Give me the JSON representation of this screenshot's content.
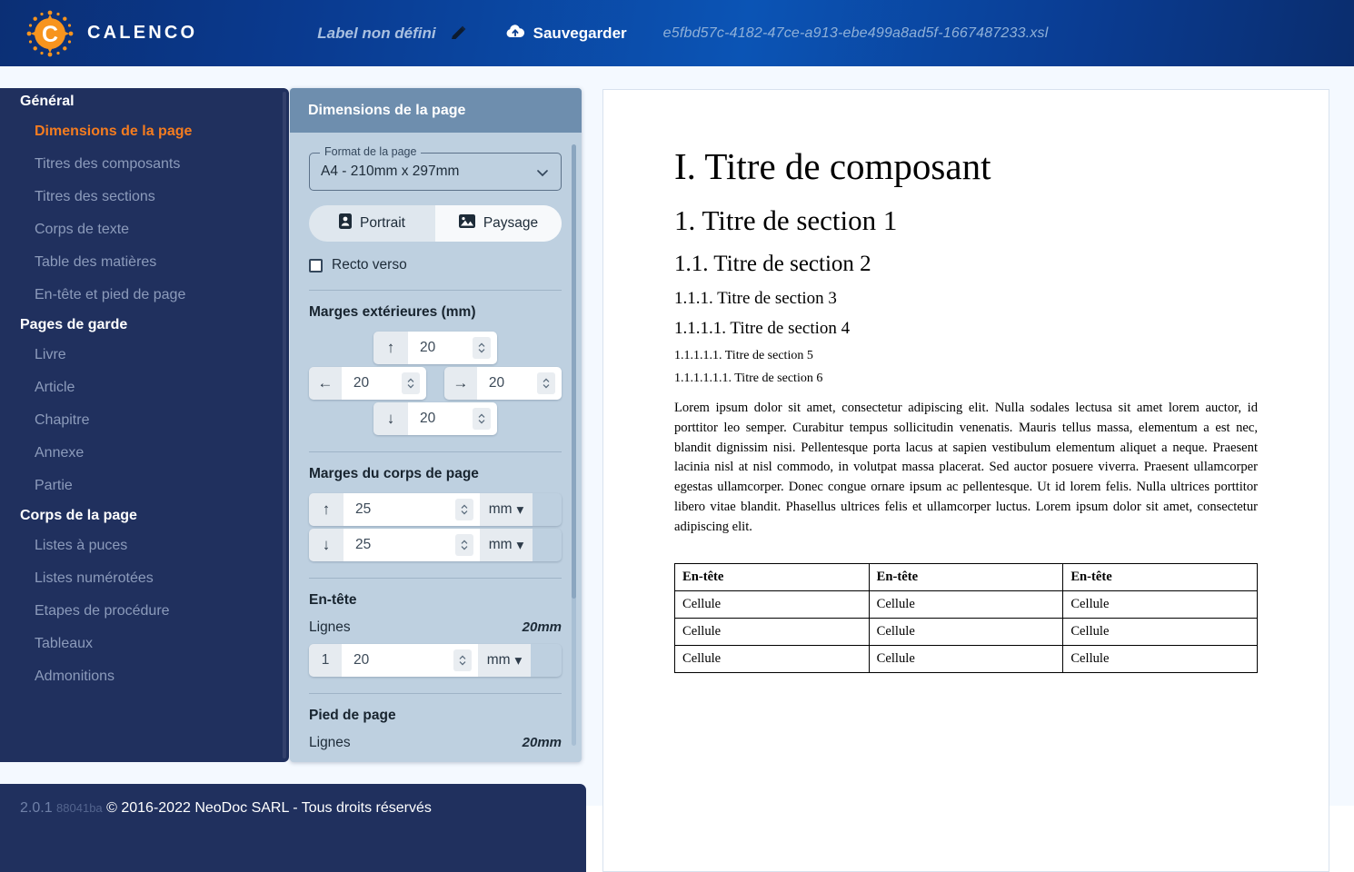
{
  "topbar": {
    "brand": "CALENCO",
    "logo_icon": "calenco-sun-logo",
    "doc_label": "Label non défini",
    "edit_icon": "pencil-icon",
    "save_icon": "cloud-upload-icon",
    "save_label": "Sauvegarder",
    "file_name": "e5fbd57c-4182-47ce-a913-ebe499a8ad5f-1667487233.xsl",
    "gradient_start": "#0b2f75",
    "gradient_mid": "#0b54b5"
  },
  "sidebar": {
    "background": "#20305e",
    "active_color": "#f57c1f",
    "sections": [
      {
        "title": "Général",
        "items": [
          {
            "label": "Dimensions de la page",
            "active": true
          },
          {
            "label": "Titres des composants",
            "active": false
          },
          {
            "label": "Titres des sections",
            "active": false
          },
          {
            "label": "Corps de texte",
            "active": false
          },
          {
            "label": "Table des matières",
            "active": false
          },
          {
            "label": "En-tête et pied de page",
            "active": false
          }
        ]
      },
      {
        "title": "Pages de garde",
        "items": [
          {
            "label": "Livre",
            "active": false
          },
          {
            "label": "Article",
            "active": false
          },
          {
            "label": "Chapitre",
            "active": false
          },
          {
            "label": "Annexe",
            "active": false
          },
          {
            "label": "Partie",
            "active": false
          }
        ]
      },
      {
        "title": "Corps de la page",
        "items": [
          {
            "label": "Listes à puces",
            "active": false
          },
          {
            "label": "Listes numérotées",
            "active": false
          },
          {
            "label": "Etapes de procédure",
            "active": false
          },
          {
            "label": "Tableaux",
            "active": false
          },
          {
            "label": "Admonitions",
            "active": false
          }
        ]
      }
    ]
  },
  "footer": {
    "version": "2.0.1",
    "build_hash": "88041ba",
    "copyright": "© 2016-2022 NeoDoc SARL - Tous droits réservés"
  },
  "settings": {
    "title": "Dimensions de la page",
    "page_format": {
      "legend": "Format de la page",
      "value": "A4 - 210mm x 297mm",
      "caret_icon": "chevron-down-icon"
    },
    "orientation": {
      "portrait_label": "Portrait",
      "portrait_icon": "portrait-icon",
      "paysage_label": "Paysage",
      "paysage_icon": "landscape-image-icon",
      "selected": "Portrait"
    },
    "duplex": {
      "label": "Recto verso",
      "checked": false
    },
    "outer_margins": {
      "title": "Marges extérieures (mm)",
      "top": "20",
      "left": "20",
      "right": "20",
      "bottom": "20"
    },
    "body_margins": {
      "title": "Marges du corps de page",
      "top": "25",
      "top_unit": "mm",
      "bottom": "25",
      "bottom_unit": "mm"
    },
    "header": {
      "title": "En-tête",
      "lines_label": "Lignes",
      "lines_value": "20mm",
      "line_count": "1",
      "value": "20",
      "unit": "mm"
    },
    "footer_section": {
      "title": "Pied de page",
      "lines_label": "Lignes",
      "lines_value": "20mm"
    }
  },
  "preview": {
    "heading_component": "I. Titre de composant",
    "heading_s1": "1. Titre de section 1",
    "heading_s2": "1.1. Titre de section 2",
    "heading_s3": "1.1.1. Titre de section 3",
    "heading_s4": "1.1.1.1. Titre de section 4",
    "heading_s5": "1.1.1.1.1. Titre de section 5",
    "heading_s6": "1.1.1.1.1.1. Titre de section 6",
    "paragraph": "Lorem ipsum dolor sit amet, consectetur adipiscing elit. Nulla sodales lectusa sit amet lorem auctor, id porttitor leo semper. Curabitur tempus sollicitudin venenatis. Mauris tellus massa, elementum a est nec, blandit dignissim nisi. Pellentesque porta lacus at sapien vestibulum elementum aliquet a neque. Praesent lacinia nisl at nisl commodo, in volutpat massa placerat. Sed auctor posuere viverra. Praesent ullamcorper egestas ullamcorper. Donec congue ornare ipsum ac pellentesque. Ut id lorem felis. Nulla ultrices porttitor libero vitae blandit. Phasellus ultrices felis et ullamcorper luctus. Lorem ipsum dolor sit amet, consectetur adipiscing elit.",
    "table": {
      "headers": [
        "En-tête",
        "En-tête",
        "En-tête"
      ],
      "rows": [
        [
          "Cellule",
          "Cellule",
          "Cellule"
        ],
        [
          "Cellule",
          "Cellule",
          "Cellule"
        ],
        [
          "Cellule",
          "Cellule",
          "Cellule"
        ]
      ]
    }
  }
}
